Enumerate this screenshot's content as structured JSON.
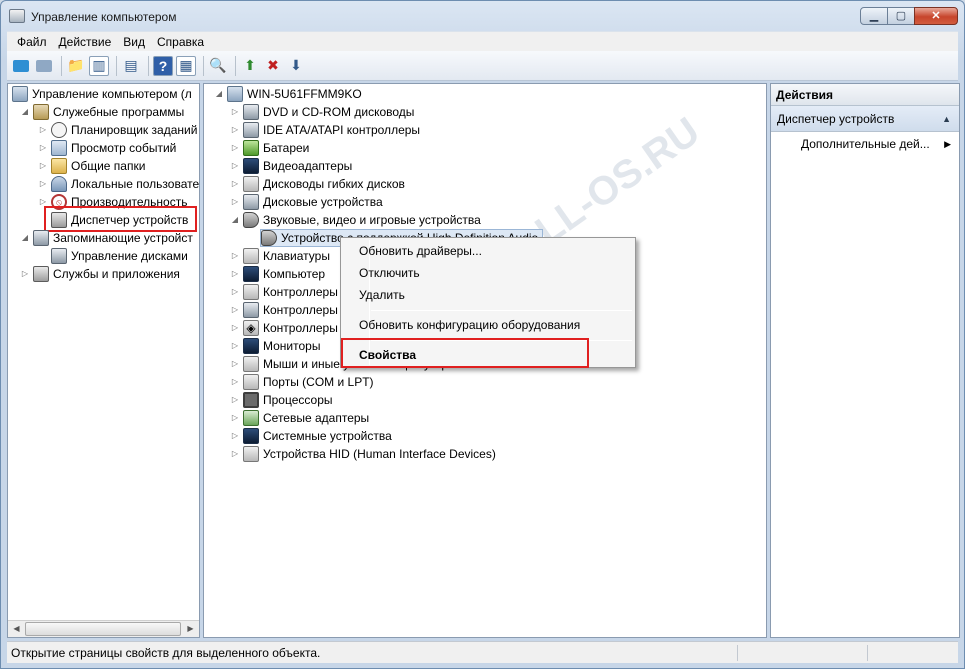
{
  "window": {
    "title": "Управление компьютером",
    "controls": {
      "minimize": "▁",
      "maximize": "▢",
      "close": "✕"
    }
  },
  "menu": [
    "Файл",
    "Действие",
    "Вид",
    "Справка"
  ],
  "left_tree": {
    "root": "Управление компьютером (л",
    "items": [
      {
        "label": "Служебные программы",
        "icon": "tools-icon"
      },
      {
        "label": "Планировщик заданий",
        "icon": "clock-icon"
      },
      {
        "label": "Просмотр событий",
        "icon": "event-log-icon"
      },
      {
        "label": "Общие папки",
        "icon": "folder-icon"
      },
      {
        "label": "Локальные пользовате",
        "icon": "users-icon"
      },
      {
        "label": "Производительность",
        "icon": "performance-icon"
      },
      {
        "label": "Диспетчер устройств",
        "icon": "device-manager-icon"
      },
      {
        "label": "Запоминающие устройст",
        "icon": "storage-icon"
      },
      {
        "label": "Управление дисками",
        "icon": "disk-management-icon"
      },
      {
        "label": "Службы и приложения",
        "icon": "services-icon"
      }
    ]
  },
  "device_tree": {
    "root": "WIN-5U61FFMM9KO",
    "categories": [
      "DVD и CD-ROM дисководы",
      "IDE ATA/ATAPI контроллеры",
      "Батареи",
      "Видеоадаптеры",
      "Дисководы гибких дисков",
      "Дисковые устройства",
      "Звуковые, видео и игровые устройства",
      "Устройство с поддержкой High Definition Audio",
      "Клавиатуры",
      "Компьютер",
      "Контроллеры",
      "Контроллеры",
      "Контроллеры",
      "Мониторы",
      "Мыши и иные указывающие устройства",
      "Порты (COM и LPT)",
      "Процессоры",
      "Сетевые адаптеры",
      "Системные устройства",
      "Устройства HID (Human Interface Devices)"
    ]
  },
  "context_menu": {
    "items": [
      "Обновить драйверы...",
      "Отключить",
      "Удалить",
      "Обновить конфигурацию оборудования",
      "Свойства"
    ]
  },
  "actions": {
    "header": "Действия",
    "section": "Диспетчер устройств",
    "item": "Дополнительные дей..."
  },
  "status": "Открытие страницы свойств для выделенного объекта.",
  "watermark": "ALL-OS.RU",
  "colors": {
    "highlight": "#e02020",
    "accent": "#2f8fd3"
  }
}
